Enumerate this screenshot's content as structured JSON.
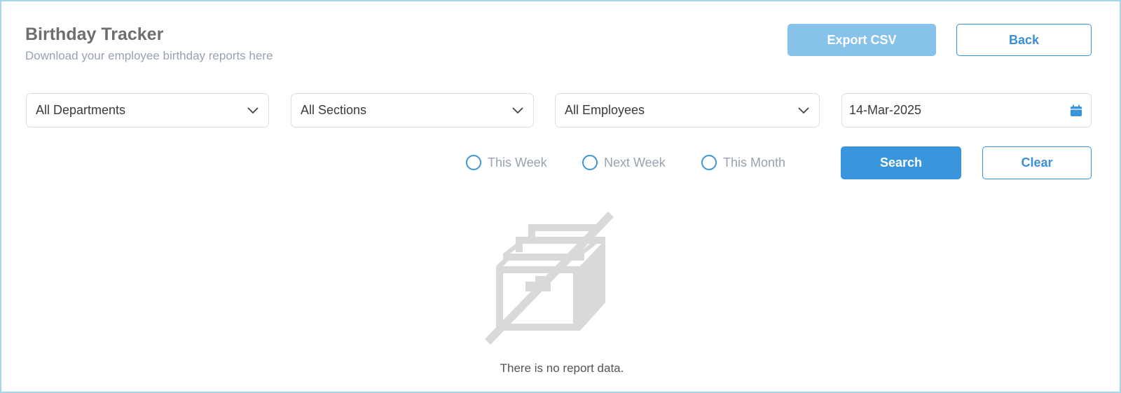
{
  "header": {
    "title": "Birthday Tracker",
    "subtitle": "Download your employee birthday reports here",
    "export_label": "Export CSV",
    "back_label": "Back"
  },
  "filters": {
    "department": "All Departments",
    "section": "All Sections",
    "employee": "All Employees",
    "date": "14-Mar-2025"
  },
  "period_options": [
    {
      "label": "This Week",
      "selected": false
    },
    {
      "label": "Next Week",
      "selected": false
    },
    {
      "label": "This Month",
      "selected": false
    }
  ],
  "actions": {
    "search_label": "Search",
    "clear_label": "Clear"
  },
  "empty_state": {
    "icon": "no-data-box-icon",
    "message": "There is no report data."
  },
  "colors": {
    "primary": "#3a96dc",
    "primary_disabled": "#87c2ea",
    "border": "#a9d4ee"
  }
}
